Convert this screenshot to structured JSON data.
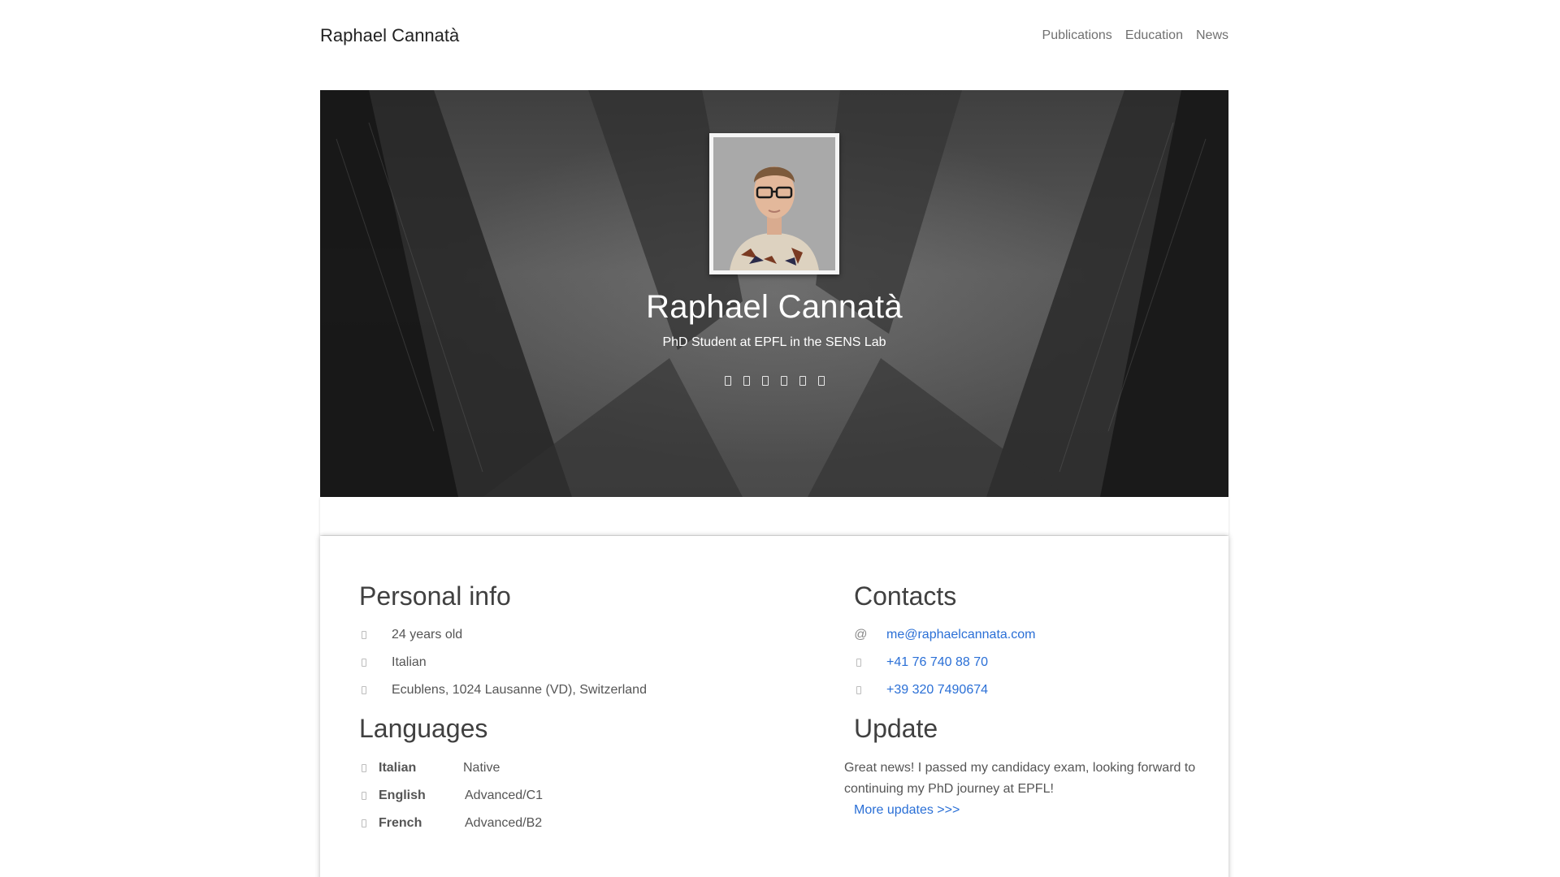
{
  "navbar": {
    "brand": "Raphael Cannatà",
    "links": [
      "Publications",
      "Education",
      "News"
    ]
  },
  "hero": {
    "name": "Raphael Cannatà",
    "subtitle": "PhD Student at EPFL in the SENS Lab",
    "social_icons": [
      "social-icon-1",
      "social-icon-2",
      "social-icon-3",
      "social-icon-4",
      "social-icon-5",
      "social-icon-6"
    ]
  },
  "personal_info": {
    "title": "Personal info",
    "age": "24 years old",
    "nationality": "Italian",
    "address": "Ecublens, 1024 Lausanne (VD), Switzerland"
  },
  "languages": {
    "title": "Languages",
    "items": [
      {
        "name": "Italian",
        "level": "Native"
      },
      {
        "name": "English",
        "level": "Advanced/C1"
      },
      {
        "name": "French",
        "level": "Advanced/B2"
      }
    ]
  },
  "contacts": {
    "title": "Contacts",
    "email_symbol": "@",
    "email": "me@raphaelcannata.com",
    "phone_ch": "+41 76 740 88 70",
    "phone_it": "+39 320 7490674"
  },
  "update": {
    "title": "Update",
    "text": "Great news! I passed my candidacy exam, looking forward to continuing my PhD journey at EPFL!",
    "more_link": "More updates >>>"
  },
  "colors": {
    "link": "#2a6fd6",
    "heading": "#404040",
    "text": "#555555"
  }
}
